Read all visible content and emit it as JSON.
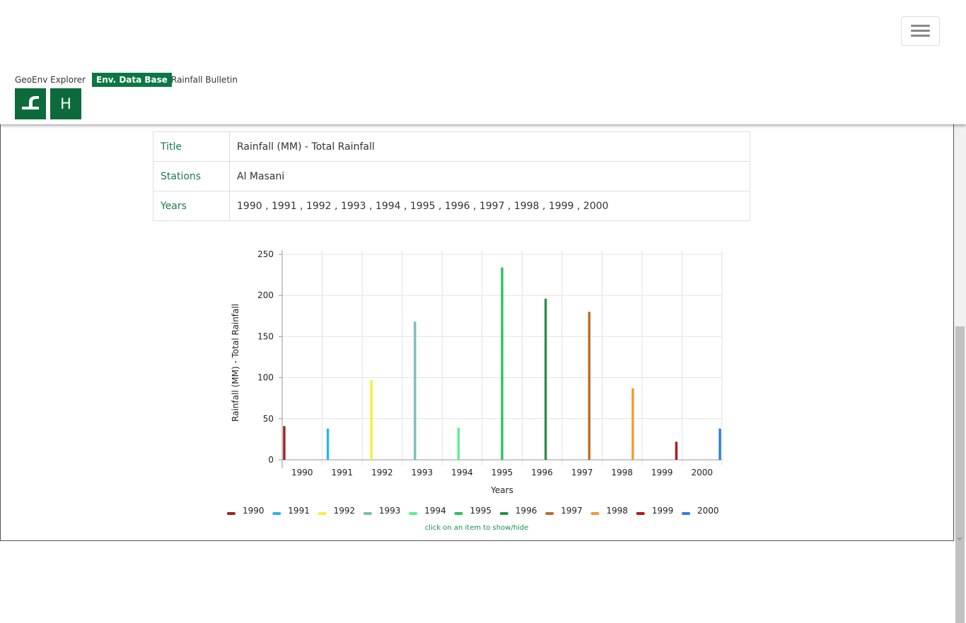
{
  "nav": {
    "items": [
      "GeoEnv Explorer",
      "Env. Data Base",
      "Rainfall Bulletin"
    ],
    "active_index": 1,
    "icon_buttons": [
      {
        "name": "logo-icon",
        "label": ""
      },
      {
        "name": "home-icon",
        "label": "H"
      }
    ],
    "accent": "#0a7744"
  },
  "info_table": {
    "rows": [
      {
        "key": "Title",
        "value": "Rainfall (MM) - Total Rainfall"
      },
      {
        "key": "Stations",
        "value": "Al Masani"
      },
      {
        "key": "Years",
        "value": "1990 , 1991 , 1992 , 1993 , 1994 , 1995 , 1996 , 1997 , 1998 , 1999 , 2000"
      }
    ]
  },
  "chart_data": {
    "type": "bar",
    "title": "",
    "xlabel": "Years",
    "ylabel": "Rainfall (MM) - Total Rainfall",
    "categories": [
      "1990",
      "1991",
      "1992",
      "1993",
      "1994",
      "1995",
      "1996",
      "1997",
      "1998",
      "1999",
      "2000"
    ],
    "series": [
      {
        "name": "1990",
        "color": "#9b2226",
        "values": [
          41,
          null,
          null,
          null,
          null,
          null,
          null,
          null,
          null,
          null,
          null
        ]
      },
      {
        "name": "1991",
        "color": "#29b6e8",
        "values": [
          null,
          38,
          null,
          null,
          null,
          null,
          null,
          null,
          null,
          null,
          null
        ]
      },
      {
        "name": "1992",
        "color": "#f5f03a",
        "values": [
          null,
          null,
          97,
          null,
          null,
          null,
          null,
          null,
          null,
          null,
          null
        ]
      },
      {
        "name": "1993",
        "color": "#7fbdb8",
        "values": [
          null,
          null,
          null,
          168,
          null,
          null,
          null,
          null,
          null,
          null,
          null
        ]
      },
      {
        "name": "1994",
        "color": "#5cf08c",
        "values": [
          null,
          null,
          null,
          null,
          39,
          null,
          null,
          null,
          null,
          null,
          null
        ]
      },
      {
        "name": "1995",
        "color": "#2fbf5f",
        "values": [
          null,
          null,
          null,
          null,
          null,
          234,
          null,
          null,
          null,
          null,
          null
        ]
      },
      {
        "name": "1996",
        "color": "#2e8b4c",
        "values": [
          null,
          null,
          null,
          null,
          null,
          null,
          196,
          null,
          null,
          null,
          null
        ]
      },
      {
        "name": "1997",
        "color": "#c06a22",
        "values": [
          null,
          null,
          null,
          null,
          null,
          null,
          null,
          180,
          null,
          null,
          null
        ]
      },
      {
        "name": "1998",
        "color": "#f29a34",
        "values": [
          null,
          null,
          null,
          null,
          null,
          null,
          null,
          null,
          87,
          null,
          null
        ]
      },
      {
        "name": "1999",
        "color": "#b3151d",
        "values": [
          null,
          null,
          null,
          null,
          null,
          null,
          null,
          null,
          null,
          22,
          null
        ]
      },
      {
        "name": "2000",
        "color": "#2f7de0",
        "values": [
          null,
          null,
          null,
          null,
          null,
          null,
          null,
          null,
          null,
          null,
          38
        ]
      }
    ],
    "ylim": [
      0,
      250
    ],
    "yticks": [
      0,
      50,
      100,
      150,
      200,
      250
    ],
    "grid": true,
    "legend_position": "bottom",
    "legend_hint": "click on an item to show/hide"
  }
}
